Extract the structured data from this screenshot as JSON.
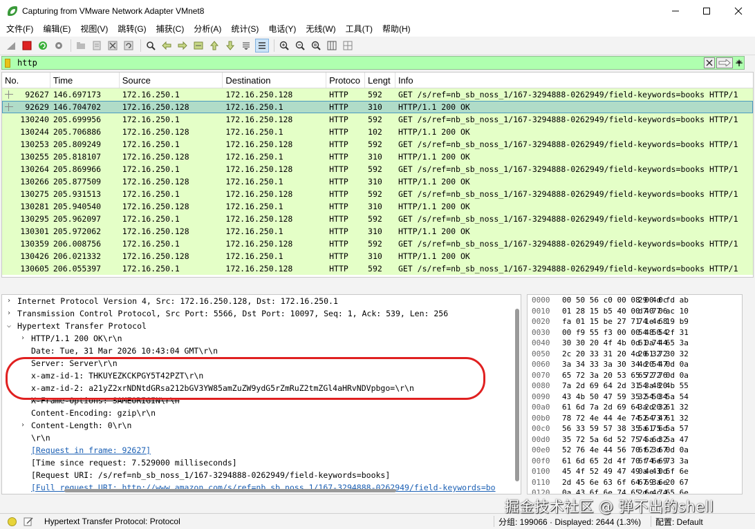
{
  "window": {
    "title": "Capturing from VMware Network Adapter VMnet8"
  },
  "menu": [
    "文件(F)",
    "编辑(E)",
    "视图(V)",
    "跳转(G)",
    "捕获(C)",
    "分析(A)",
    "统计(S)",
    "电话(Y)",
    "无线(W)",
    "工具(T)",
    "帮助(H)"
  ],
  "filter": {
    "value": "http"
  },
  "packet_list": {
    "columns": [
      "No.",
      "Time",
      "Source",
      "Destination",
      "Protocol",
      "Length",
      "Info"
    ],
    "column_labels_shown": [
      "No.",
      "Time",
      "Source",
      "Destination",
      "Protoco",
      "Lengt",
      "Info"
    ],
    "rows": [
      {
        "no": "92627",
        "time": "146.697173",
        "src": "172.16.250.1",
        "dst": "172.16.250.128",
        "proto": "HTTP",
        "len": "592",
        "info": "GET /s/ref=nb_sb_noss_1/167-3294888-0262949/field-keywords=books HTTP/1"
      },
      {
        "no": "92629",
        "time": "146.704702",
        "src": "172.16.250.128",
        "dst": "172.16.250.1",
        "proto": "HTTP",
        "len": "310",
        "info": "HTTP/1.1 200 OK"
      },
      {
        "no": "130240",
        "time": "205.699956",
        "src": "172.16.250.1",
        "dst": "172.16.250.128",
        "proto": "HTTP",
        "len": "592",
        "info": "GET /s/ref=nb_sb_noss_1/167-3294888-0262949/field-keywords=books HTTP/1"
      },
      {
        "no": "130244",
        "time": "205.706886",
        "src": "172.16.250.128",
        "dst": "172.16.250.1",
        "proto": "HTTP",
        "len": "102",
        "info": "HTTP/1.1 200 OK"
      },
      {
        "no": "130253",
        "time": "205.809249",
        "src": "172.16.250.1",
        "dst": "172.16.250.128",
        "proto": "HTTP",
        "len": "592",
        "info": "GET /s/ref=nb_sb_noss_1/167-3294888-0262949/field-keywords=books HTTP/1"
      },
      {
        "no": "130255",
        "time": "205.818107",
        "src": "172.16.250.128",
        "dst": "172.16.250.1",
        "proto": "HTTP",
        "len": "310",
        "info": "HTTP/1.1 200 OK"
      },
      {
        "no": "130264",
        "time": "205.869966",
        "src": "172.16.250.1",
        "dst": "172.16.250.128",
        "proto": "HTTP",
        "len": "592",
        "info": "GET /s/ref=nb_sb_noss_1/167-3294888-0262949/field-keywords=books HTTP/1"
      },
      {
        "no": "130266",
        "time": "205.877509",
        "src": "172.16.250.128",
        "dst": "172.16.250.1",
        "proto": "HTTP",
        "len": "310",
        "info": "HTTP/1.1 200 OK"
      },
      {
        "no": "130275",
        "time": "205.931513",
        "src": "172.16.250.1",
        "dst": "172.16.250.128",
        "proto": "HTTP",
        "len": "592",
        "info": "GET /s/ref=nb_sb_noss_1/167-3294888-0262949/field-keywords=books HTTP/1"
      },
      {
        "no": "130281",
        "time": "205.940540",
        "src": "172.16.250.128",
        "dst": "172.16.250.1",
        "proto": "HTTP",
        "len": "310",
        "info": "HTTP/1.1 200 OK"
      },
      {
        "no": "130295",
        "time": "205.962097",
        "src": "172.16.250.1",
        "dst": "172.16.250.128",
        "proto": "HTTP",
        "len": "592",
        "info": "GET /s/ref=nb_sb_noss_1/167-3294888-0262949/field-keywords=books HTTP/1"
      },
      {
        "no": "130301",
        "time": "205.972062",
        "src": "172.16.250.128",
        "dst": "172.16.250.1",
        "proto": "HTTP",
        "len": "310",
        "info": "HTTP/1.1 200 OK"
      },
      {
        "no": "130359",
        "time": "206.008756",
        "src": "172.16.250.1",
        "dst": "172.16.250.128",
        "proto": "HTTP",
        "len": "592",
        "info": "GET /s/ref=nb_sb_noss_1/167-3294888-0262949/field-keywords=books HTTP/1"
      },
      {
        "no": "130426",
        "time": "206.021332",
        "src": "172.16.250.128",
        "dst": "172.16.250.1",
        "proto": "HTTP",
        "len": "310",
        "info": "HTTP/1.1 200 OK"
      },
      {
        "no": "130605",
        "time": "206.055397",
        "src": "172.16.250.1",
        "dst": "172.16.250.128",
        "proto": "HTTP",
        "len": "592",
        "info": "GET /s/ref=nb_sb_noss_1/167-3294888-0262949/field-keywords=books HTTP/1"
      }
    ]
  },
  "details": {
    "ip": "Internet Protocol Version 4, Src: 172.16.250.128, Dst: 172.16.250.1",
    "tcp": "Transmission Control Protocol, Src Port: 5566, Dst Port: 10097, Seq: 1, Ack: 539, Len: 256",
    "http": "Hypertext Transfer Protocol",
    "status_line": "HTTP/1.1 200 OK\\r\\n",
    "date": "Date: Tue, 31 Mar 2026 10:43:04 GMT\\r\\n",
    "server": "Server: Server\\r\\n",
    "amz1": "x-amz-id-1: THKUYEZKCKPGY5T42PZT\\r\\n",
    "amz2": "x-amz-id-2: a21yZ2xrNDNtdGRsa212bGV3YW85amZuZW9ydG5rZmRuZ2tmZGl4aHRvNDVpbgo=\\r\\n",
    "xframe": "X-Frame-Options: SAMEORIGIN\\r\\n",
    "encoding": "Content-Encoding: gzip\\r\\n",
    "content_length": "Content-Length: 0\\r\\n",
    "crlf": "\\r\\n",
    "request_in": "[Request in frame: 92627]",
    "time_since": "[Time since request: 7.529000 milliseconds]",
    "request_uri": "[Request URI: /s/ref=nb_sb_noss_1/167-3294888-0262949/field-keywords=books]",
    "full_uri": "[Full request URI: http://www.amazon.com/s/ref=nb_sb_noss_1/167-3294888-0262949/field-keywords=bo"
  },
  "hex": [
    {
      "off": "0000",
      "a": "00 50 56 c0 00 08 00 0c",
      "b": "29 4d fd ab"
    },
    {
      "off": "0010",
      "a": "01 28 15 b5 40 00 40 06",
      "b": "d7 77 ac 10"
    },
    {
      "off": "0020",
      "a": "fa 01 15 be 27 71 1e 68",
      "b": "74 4c 19 b9"
    },
    {
      "off": "0030",
      "a": "00 f9 55 f3 00 00 48 54",
      "b": "54 50 2f 31"
    },
    {
      "off": "0040",
      "a": "30 30 20 4f 4b 0d 0a 44",
      "b": "61 74 65 3a"
    },
    {
      "off": "0050",
      "a": "2c 20 33 31 20 4d 61 72",
      "b": "20 32 30 32"
    },
    {
      "off": "0060",
      "a": "3a 34 33 3a 30 34 20 47",
      "b": "4d 54 0d 0a"
    },
    {
      "off": "0070",
      "a": "65 72 3a 20 53 65 72 76",
      "b": "65 72 0d 0a"
    },
    {
      "off": "0080",
      "a": "7a 2d 69 64 2d 31 3a 20",
      "b": "54 48 4b 55"
    },
    {
      "off": "0090",
      "a": "43 4b 50 47 59 35 54 34",
      "b": "32 50 5a 54"
    },
    {
      "off": "00a0",
      "a": "61 6d 7a 2d 69 64 2d 32",
      "b": "3a 20 61 32"
    },
    {
      "off": "00b0",
      "a": "78 72 4e 44 4e 74 64 47",
      "b": "52 73 61 32"
    },
    {
      "off": "00c0",
      "a": "56 33 59 57 38 35 61 6d",
      "b": "5a 75 5a 57"
    },
    {
      "off": "00d0",
      "a": "35 72 5a 6d 52 75 5a 32",
      "b": "74 6d 5a 47"
    },
    {
      "off": "00e0",
      "a": "52 76 4e 44 56 70 62 67",
      "b": "6f 3d 0d 0a"
    },
    {
      "off": "00f0",
      "a": "61 6d 65 2d 4f 70 74 69",
      "b": "6f 6e 73 3a"
    },
    {
      "off": "0100",
      "a": "45 4f 52 49 47 49 4e 0d",
      "b": "0a 43 6f 6e"
    },
    {
      "off": "0110",
      "a": "2d 45 6e 63 6f 64 69 6e",
      "b": "67 3a 20 67"
    },
    {
      "off": "0120",
      "a": "0a 43 6f 6e 74 65 6e 74",
      "b": "2d 4c 65 6e"
    },
    {
      "off": "0130",
      "a": "30 30 0d 0a 0d 0a",
      "b": ""
    }
  ],
  "status": {
    "field": "Hypertext Transfer Protocol: Protocol",
    "counts": "分组: 199066 · Displayed: 2644 (1.3%)",
    "profile": "配置: Default"
  },
  "watermark": "掘金技术社区 @ 弹不出的shell",
  "colors": {
    "filter_ok": "#afffaf",
    "row_http": "#e4ffc7",
    "row_selected": "#b0dcc8",
    "annotation": "#e02020"
  }
}
